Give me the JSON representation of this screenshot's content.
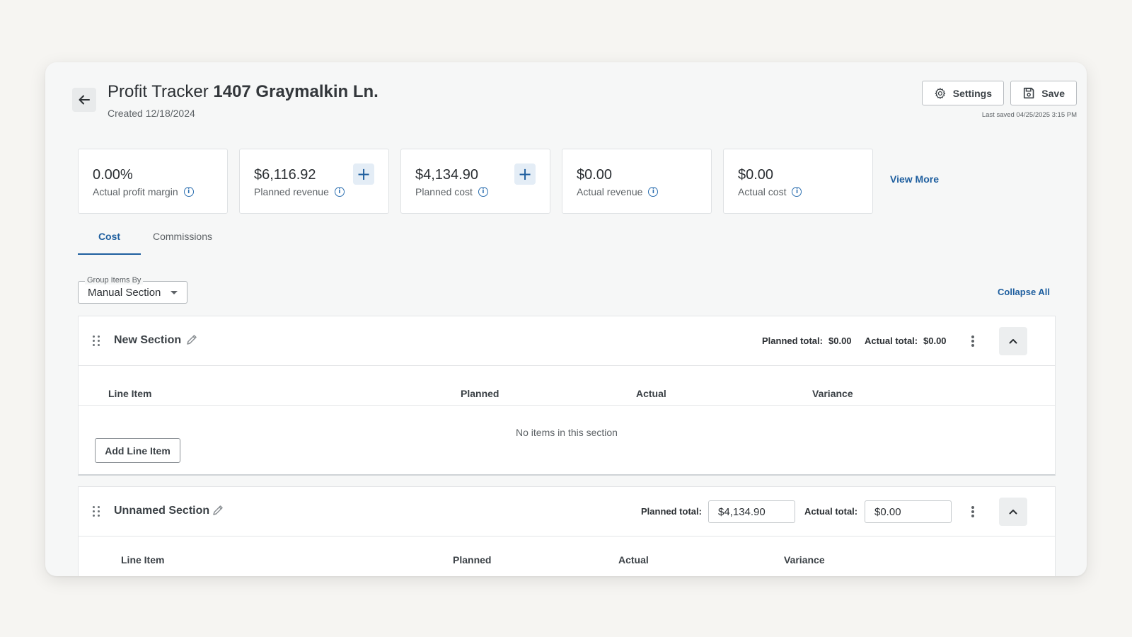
{
  "header": {
    "title_prefix": "Profit Tracker",
    "title_address": "1407 Graymalkin Ln.",
    "created": "Created 12/18/2024",
    "settings_label": "Settings",
    "save_label": "Save",
    "last_saved": "Last saved 04/25/2025 3:15 PM"
  },
  "metrics": [
    {
      "value": "0.00%",
      "label": "Actual profit margin",
      "has_add": false
    },
    {
      "value": "$6,116.92",
      "label": "Planned revenue",
      "has_add": true
    },
    {
      "value": "$4,134.90",
      "label": "Planned cost",
      "has_add": true
    },
    {
      "value": "$0.00",
      "label": "Actual revenue",
      "has_add": false
    },
    {
      "value": "$0.00",
      "label": "Actual cost",
      "has_add": false
    }
  ],
  "view_more": "View More",
  "tabs": [
    {
      "label": "Cost",
      "active": true
    },
    {
      "label": "Commissions",
      "active": false
    }
  ],
  "group_by": {
    "legend": "Group Items By",
    "value": "Manual Section"
  },
  "collapse_all": "Collapse All",
  "sections": [
    {
      "title": "New Section",
      "planned_total_label": "Planned total:",
      "planned_total": "$0.00",
      "actual_total_label": "Actual total:",
      "actual_total": "$0.00",
      "columns": [
        "Line Item",
        "Planned",
        "Actual",
        "Variance"
      ],
      "empty_message": "No items in this section",
      "add_button": "Add Line Item"
    },
    {
      "title": "Unnamed Section",
      "planned_total_label": "Planned total:",
      "planned_total": "$4,134.90",
      "actual_total_label": "Actual total:",
      "actual_total": "$0.00",
      "columns": [
        "Line Item",
        "Planned",
        "Actual",
        "Variance"
      ]
    }
  ],
  "colors": {
    "accent": "#1f5f9f",
    "page_bg": "#f6f5f2",
    "window_bg": "#f6f7f7",
    "card_bg": "#ffffff"
  },
  "icons": {
    "back": "arrow-left-icon",
    "settings": "gear-icon",
    "save": "floppy-disk-icon",
    "info": "info-circle-icon",
    "add": "plus-icon",
    "drag": "drag-handle-icon",
    "edit": "pencil-icon",
    "more": "kebab-menu-icon",
    "collapse": "chevron-up-icon",
    "dropdown": "caret-down-icon"
  }
}
